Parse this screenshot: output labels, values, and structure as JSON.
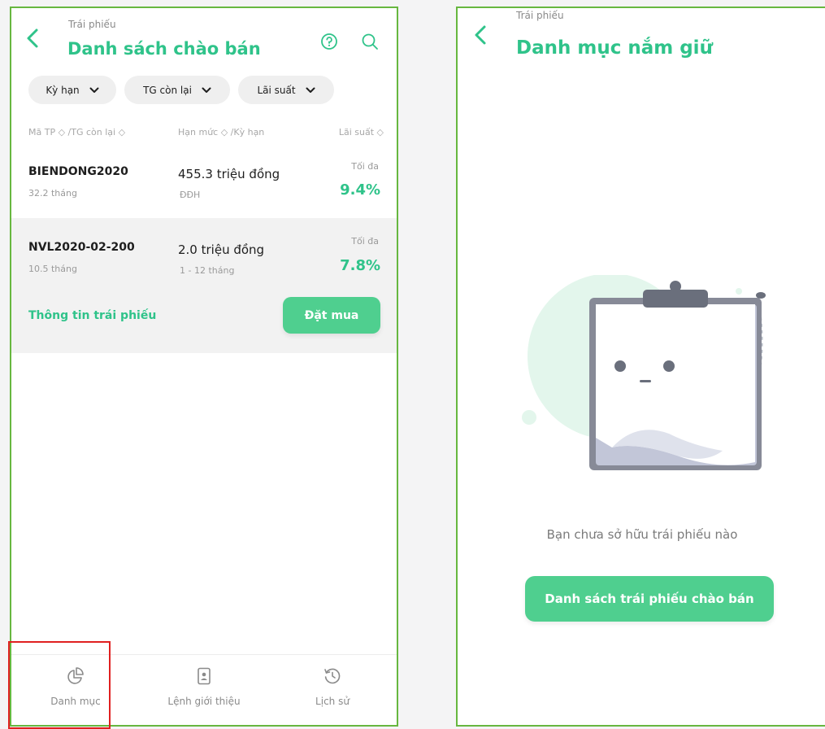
{
  "left": {
    "header": {
      "subtitle": "Trái phiếu",
      "title": "Danh sách chào bán"
    },
    "filters": [
      {
        "label": "Kỳ hạn"
      },
      {
        "label": "TG còn lại"
      },
      {
        "label": "Lãi suất"
      }
    ],
    "columns": {
      "code": "Mã TP ◇ /TG còn lại ◇",
      "limit": "Hạn mức ◇ /Kỳ hạn",
      "rate": "Lãi suất ◇"
    },
    "bonds": [
      {
        "code": "BIENDONG2020",
        "remaining": "32.2 tháng",
        "amount": "455.3 triệu đồng",
        "term": "ĐĐH",
        "max_label": "Tối đa",
        "rate": "9.4%"
      },
      {
        "code": "NVL2020-02-200",
        "remaining": "10.5 tháng",
        "amount": "2.0 triệu đồng",
        "term": "1 - 12 tháng",
        "max_label": "Tối đa",
        "rate": "7.8%"
      }
    ],
    "expanded": {
      "info_link": "Thông tin trái phiếu",
      "buy_button": "Đặt mua"
    },
    "nav": [
      {
        "label": "Danh mục",
        "icon": "pie-chart-icon"
      },
      {
        "label": "Lệnh giới thiệu",
        "icon": "document-user-icon"
      },
      {
        "label": "Lịch sử",
        "icon": "history-icon"
      }
    ]
  },
  "right": {
    "header": {
      "subtitle": "Trái phiếu",
      "title": "Danh mục nắm giữ"
    },
    "empty_message": "Bạn chưa sở hữu trái phiếu nào",
    "cta_button": "Danh sách trái phiếu chào bán"
  },
  "colors": {
    "accent": "#2fc38a",
    "button": "#4fcf8f",
    "panel_border": "#67b73f",
    "highlight": "#e02020"
  }
}
